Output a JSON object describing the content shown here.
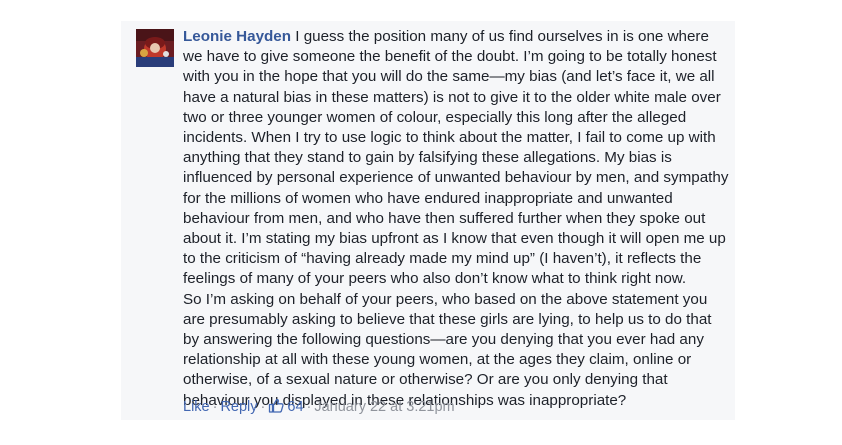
{
  "comment": {
    "author": "Leonie Hayden",
    "paragraphs": [
      "I guess the position many of us find ourselves in is one where we have to give someone the benefit of the doubt. I’m going to be totally honest with you in the hope that you will do the same—my bias (and let’s face it, we all have a natural bias in these matters) is not to give it to the older white male over two or three younger women of colour, especially this long after the alleged incidents. When I try to use logic to think about the matter, I fail to come up with anything that they stand to gain by falsifying these allegations. My bias is influenced by personal experience of unwanted behaviour by men, and sympathy for the millions of women who have endured inappropriate and unwanted behaviour from men, and who have then suffered further when they spoke out about it. I’m stating my bias upfront as I know that even though it will open me up to the criticism of “having already made my mind up” (I haven’t), it reflects the feelings of many of your peers who also don’t know what to think right now.",
      "So I’m asking on behalf of your peers, who based on the above statement you are presumably asking to believe that these girls are lying, to help us to do that by answering the following questions—are you denying that you ever had any relationship at all with these young women, at the ages they claim, online or otherwise, of a sexual nature or otherwise? Or are you only denying that behaviour you displayed in these relationships was inappropriate?"
    ]
  },
  "actions": {
    "like_label": "Like",
    "separator": "·",
    "reply_label": "Reply",
    "like_icon": "thumbs-up-outline-icon",
    "like_count": "64",
    "timestamp": "January 22 at 3:21pm"
  },
  "colors": {
    "author_name": "#365899",
    "link": "#4267b2",
    "meta": "#90949c",
    "body_text": "#1d2129",
    "card_background": "#f6f7f9"
  }
}
